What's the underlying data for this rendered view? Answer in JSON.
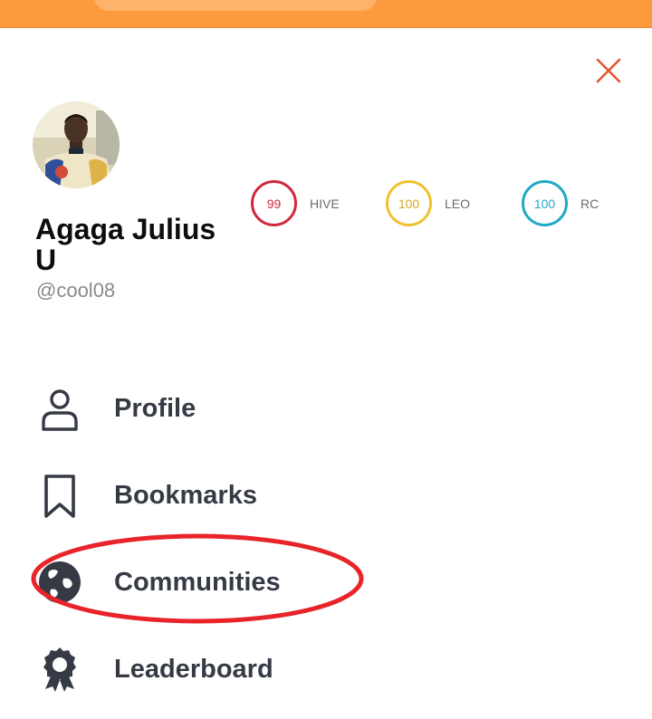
{
  "user": {
    "name": "Agaga Julius U",
    "handle": "@cool08"
  },
  "stats": [
    {
      "value": "99",
      "label": "HIVE",
      "color": "#d0283c"
    },
    {
      "value": "100",
      "label": "LEO",
      "color": "#f0c12e"
    },
    {
      "value": "100",
      "label": "RC",
      "color": "#1fa9c6"
    }
  ],
  "menu": {
    "items": [
      {
        "label": "Profile",
        "icon": "user-icon"
      },
      {
        "label": "Bookmarks",
        "icon": "bookmark-icon"
      },
      {
        "label": "Communities",
        "icon": "globe-icon"
      },
      {
        "label": "Leaderboard",
        "icon": "award-badge-icon"
      }
    ]
  },
  "colors": {
    "topbar": "#fd9a3e",
    "close": "#e2582f",
    "highlight": "#e8242a"
  }
}
